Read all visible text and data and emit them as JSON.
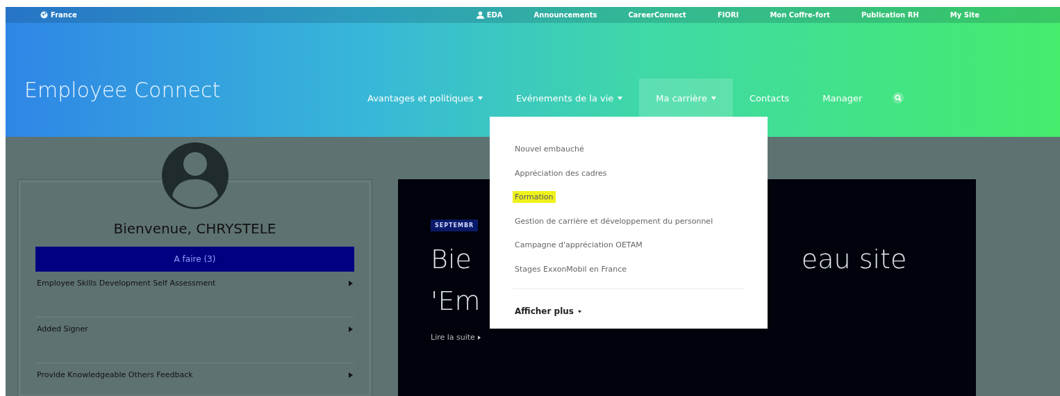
{
  "top_bar": {
    "region": "France",
    "user": "EDA",
    "links": [
      "Announcements",
      "CareerConnect",
      "FIORI",
      "Mon Coffre-fort",
      "Publication RH",
      "My Site"
    ]
  },
  "header": {
    "title": "Employee Connect",
    "nav": [
      {
        "label": "Avantages et politiques",
        "dropdown": true,
        "selected": false
      },
      {
        "label": "Evénements de la vie",
        "dropdown": true,
        "selected": false
      },
      {
        "label": "Ma carrière",
        "dropdown": true,
        "selected": true
      },
      {
        "label": "Contacts",
        "dropdown": false,
        "selected": false
      },
      {
        "label": "Manager",
        "dropdown": false,
        "selected": false
      }
    ]
  },
  "dropdown_menu": {
    "items": [
      {
        "label": "Nouvel embauché",
        "highlighted": false
      },
      {
        "label": "Appréciation des cadres",
        "highlighted": false
      },
      {
        "label": "Formation",
        "highlighted": true
      },
      {
        "label": "Gestion de carrière et développement du personnel",
        "highlighted": false
      },
      {
        "label": "Campagne d'appréciation OETAM",
        "highlighted": false
      },
      {
        "label": "Stages ExxonMobil en France",
        "highlighted": false
      }
    ],
    "more": "Afficher plus"
  },
  "welcome_card": {
    "greeting": "Bienvenue, CHRYSTELE",
    "todo_header": "A faire (3)",
    "tasks": [
      "Employee Skills Development Self Assessment",
      "Added Signer",
      "Provide Knowledgeable Others Feedback"
    ]
  },
  "hero": {
    "tag": "SEPTEMBR",
    "title_left_line_1": "Bie",
    "title_right_line_1": "eau site",
    "title_left_line_2": "'Em",
    "link": "Lire la suite"
  }
}
